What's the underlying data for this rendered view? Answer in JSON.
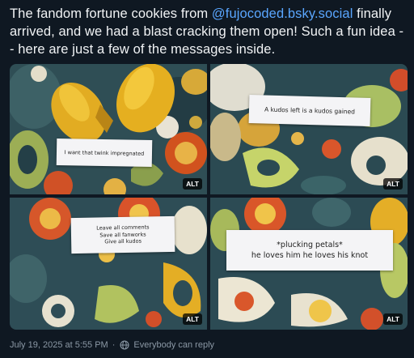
{
  "post": {
    "text_before": "The fandom fortune cookies from ",
    "mention": "@fujocoded.bsky.social",
    "text_after": " finally arrived, and we had a blast cracking them open! Such a fun idea -- here are just a few of the messages inside."
  },
  "images": [
    {
      "lines": [
        "I want that twink impregnated"
      ],
      "alt_badge": "ALT"
    },
    {
      "lines": [
        "A kudos left is a kudos gained"
      ],
      "alt_badge": "ALT"
    },
    {
      "lines": [
        "Leave all comments",
        "Save all fanworks",
        "Give all kudos"
      ],
      "alt_badge": "ALT"
    },
    {
      "lines": [
        "*plucking petals*",
        "he loves him he loves his knot"
      ],
      "alt_badge": "ALT"
    }
  ],
  "footer": {
    "timestamp": "July 19, 2025 at 5:55 PM",
    "separator": "·",
    "reply_setting": "Everybody can reply",
    "colors": {
      "meta": "#8b98a5",
      "mention": "#5aa6ff",
      "background": "#0f1822"
    }
  }
}
